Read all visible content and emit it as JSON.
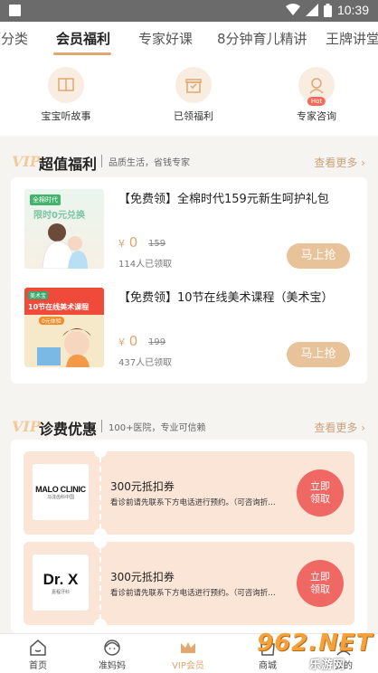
{
  "status_bar": {
    "time": "10:39"
  },
  "tabs": [
    "领分类",
    "会员福利",
    "专家好课",
    "8分钟育儿精讲",
    "王牌讲堂"
  ],
  "active_tab": 1,
  "shortcuts": [
    {
      "label": "宝宝听故事",
      "icon": "book-icon"
    },
    {
      "label": "已领福利",
      "icon": "gift-icon"
    },
    {
      "label": "专家咨询",
      "icon": "expert-icon",
      "badge": "Hot"
    }
  ],
  "benefits": {
    "vip": "VIP",
    "title": "超值福利",
    "subtitle": "品质生活，省钱专家",
    "more": "查看更多",
    "items": [
      {
        "title": "【免费领】全棉时代159元新生呵护礼包",
        "currency": "¥",
        "price": "0",
        "old_price": "159",
        "claimed": "114人已领取",
        "button": "马上抢",
        "thumb_text": "限时0元兑换"
      },
      {
        "title": "【免费领】10节在线美术课程（美术宝）",
        "currency": "¥",
        "price": "0",
        "old_price": "199",
        "claimed": "437人已领取",
        "button": "马上抢",
        "thumb_text": "10节在线美术课程",
        "thumb_sub": "0元体验"
      }
    ]
  },
  "clinic": {
    "vip": "VIP",
    "title": "诊费优惠",
    "subtitle": "100+医院，专业可信赖",
    "more": "查看更多",
    "coupons": [
      {
        "logo": "MALO CLINIC",
        "logo_sub": "马泷齿科中国",
        "title": "300元抵扣券",
        "desc": "看诊前请先联系下方电话进行预约。（可咨询折…",
        "button": "立即领取"
      },
      {
        "logo": "Dr. X",
        "logo_sub": "嘉程牙科",
        "title": "300元抵扣券",
        "desc": "看诊前请先联系下方电话进行预约。（可咨询折…",
        "button": "立即领取"
      }
    ]
  },
  "bottom_nav": [
    {
      "label": "首页",
      "icon": "home-icon"
    },
    {
      "label": "准妈妈",
      "icon": "mom-icon"
    },
    {
      "label": "VIP会员",
      "icon": "crown-icon",
      "active": true
    },
    {
      "label": "商城",
      "icon": "shop-icon"
    },
    {
      "label": "我的",
      "icon": "user-icon"
    }
  ],
  "watermark": {
    "text": "962.NET",
    "sub": "乐游网"
  },
  "colors": {
    "accent": "#e0a770",
    "claim_red": "#f06863",
    "coupon_bg": "#fbe5d7"
  }
}
